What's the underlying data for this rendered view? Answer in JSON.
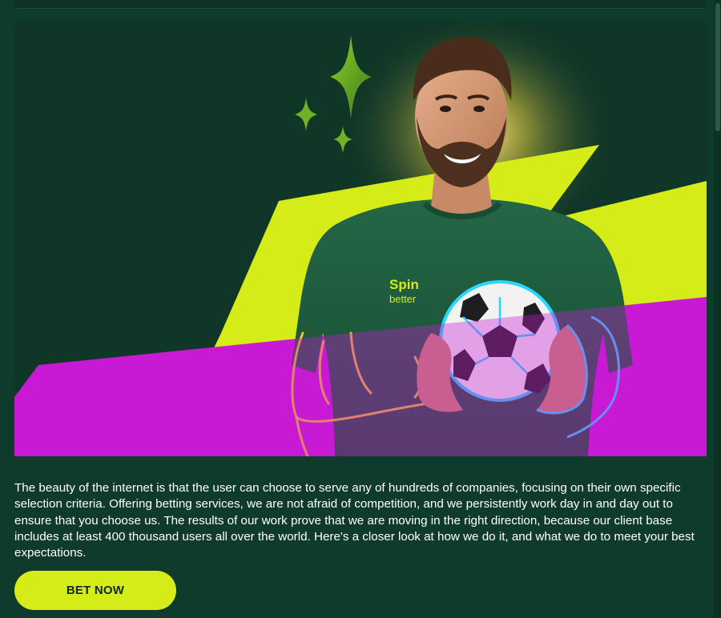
{
  "hero": {
    "shirt_brand_line1": "Spin",
    "shirt_brand_line2": "better"
  },
  "intro": {
    "text": "The beauty of the internet is that the user can choose to serve any of hundreds of companies, focusing on their own specific selection criteria. Offering betting services, we are not afraid of competition, and we persistently work day in and day out to ensure that you choose us. The results of our work prove that we are moving in the right direction, because our client base includes at least 400 thousand users all over the world. Here's a closer look at how we do it, and what we do to meet your best expectations."
  },
  "cta": {
    "label": "BET NOW"
  },
  "colors": {
    "page_bg": "#0f3b2c",
    "hero_bg": "#103628",
    "lime": "#d6ec18",
    "magenta": "#c81ad6",
    "shirt": "#1f5a3c",
    "text": "#ffffff"
  },
  "icons": {
    "sparkle": "four-point-star",
    "ball": "soccer-ball"
  }
}
